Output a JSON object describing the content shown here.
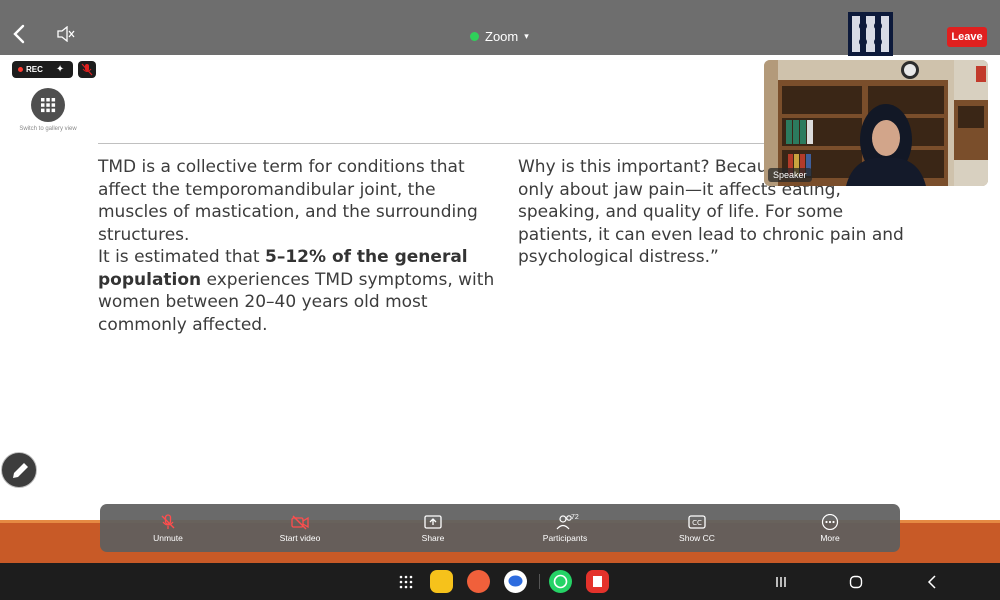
{
  "header": {
    "app_title": "Zoom",
    "leave_label": "Leave"
  },
  "recording": {
    "rec_label": "REC"
  },
  "gallery": {
    "label": "Switch to gallery view"
  },
  "slide": {
    "left_para_1": "TMD is a collective term for conditions that affect the temporomandibular joint, the muscles of mastication, and the surrounding structures.",
    "left_para_2_start": "It is estimated that ",
    "left_para_2_bold": "5–12% of the general population",
    "left_para_2_end": " experiences TMD symptoms, with women between 20–40 years old most commonly affected.",
    "right_text": "Why is this important? Becau\nonly about jaw pain—it affects eating,\nspeaking, and quality of life. For some\npatients, it can even lead to chronic pain and\npsychological distress.”"
  },
  "video": {
    "speaker_label": "Speaker"
  },
  "toolbar": {
    "unmute_label": "Unmute",
    "start_video_label": "Start video",
    "share_label": "Share",
    "participants_label": "Participants",
    "participants_count": "72",
    "show_cc_label": "Show CC",
    "more_label": "More"
  },
  "colors": {
    "leave_red": "#e0201f",
    "band_orange": "#c85a27",
    "status_green": "#2fd15a"
  },
  "icons": {
    "back": "chevron-left-icon",
    "audio": "audio-output-muted-icon",
    "mic": "microphone-muted-icon",
    "video": "video-off-icon",
    "share": "share-screen-icon",
    "participants": "participants-icon",
    "cc": "closed-caption-icon",
    "more": "more-dots-icon",
    "edit": "pencil-icon"
  }
}
